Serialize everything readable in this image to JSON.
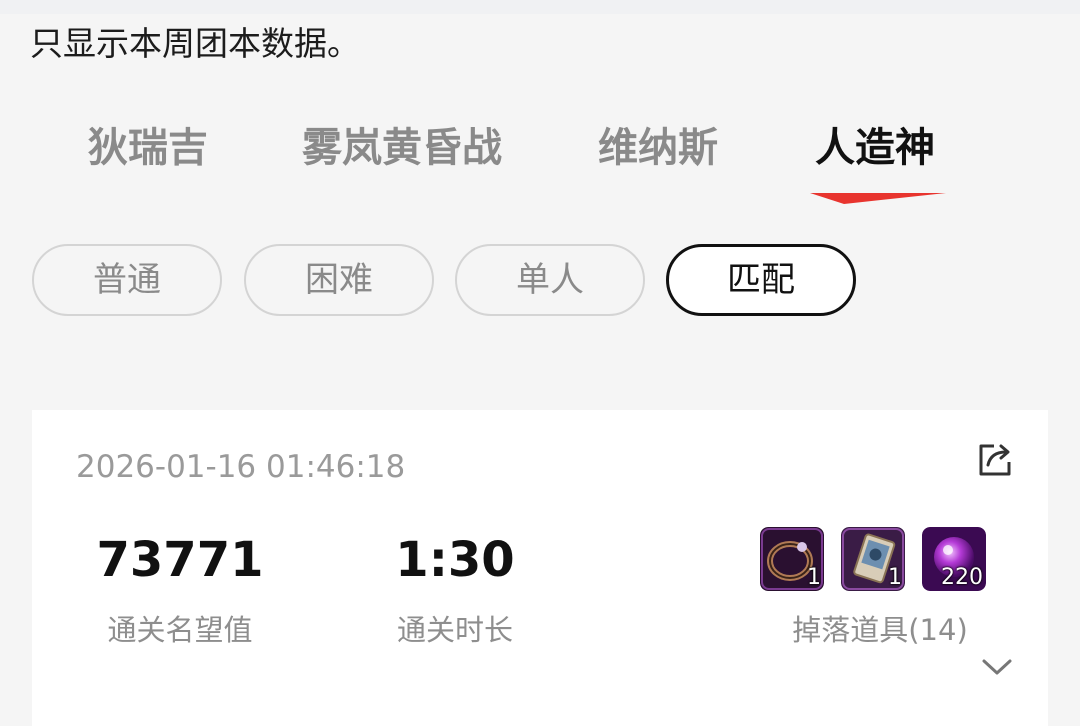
{
  "notice": "只显示本周团本数据。",
  "tabs": [
    {
      "label": "狄瑞吉",
      "active": false
    },
    {
      "label": "雾岚黄昏战",
      "active": false
    },
    {
      "label": "维纳斯",
      "active": false
    },
    {
      "label": "人造神",
      "active": true
    }
  ],
  "filters": [
    {
      "label": "普通",
      "active": false
    },
    {
      "label": "困难",
      "active": false
    },
    {
      "label": "单人",
      "active": false
    },
    {
      "label": "匹配",
      "active": true
    }
  ],
  "record": {
    "timestamp": "2026-01-16 01:46:18",
    "reputation": {
      "value": "73771",
      "label": "通关名望值"
    },
    "duration": {
      "value": "1:30",
      "label": "通关时长"
    },
    "drops": {
      "label": "掉落道具(14)",
      "items": [
        {
          "icon": "dark-ring-icon",
          "count": "1"
        },
        {
          "icon": "card-icon",
          "count": "1"
        },
        {
          "icon": "purple-orb-icon",
          "count": "220"
        }
      ]
    }
  },
  "colors": {
    "accent_underline": "#e8342e",
    "active_text": "#111111",
    "inactive_text": "#8a8a8a",
    "background": "#f5f5f5",
    "card": "#ffffff"
  }
}
